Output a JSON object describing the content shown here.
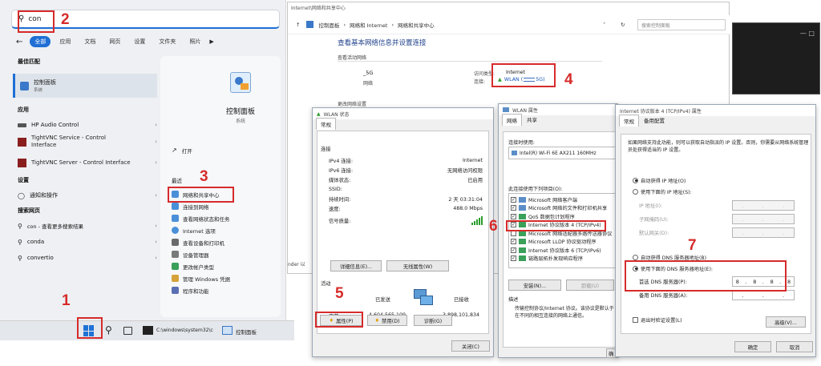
{
  "annotations": [
    "1",
    "2",
    "3",
    "4",
    "5",
    "6",
    "7"
  ],
  "start_menu": {
    "search_value": "con",
    "filters": [
      "全部",
      "应用",
      "文档",
      "网页",
      "设置",
      "文件夹",
      "照片"
    ],
    "best_match_header": "最佳匹配",
    "best_match": {
      "title": "控制面板",
      "subtitle": "系统"
    },
    "apps_header": "应用",
    "apps": [
      "HP Audio Control",
      "TightVNC Service - Control Interface",
      "TightVNC Server - Control Interface"
    ],
    "settings_header": "设置",
    "settings": [
      "通知和操作"
    ],
    "web_header": "搜索网页",
    "web": [
      "con - 查看更多搜索结果",
      "conda",
      "convertio"
    ],
    "right_title": "控制面板",
    "right_subtitle": "系统",
    "open_label": "打开",
    "recent_header": "最近",
    "recent": [
      "网络和共享中心",
      "连接到网络",
      "查看网络状态和任务",
      "Internet 选项",
      "查看设备和打印机",
      "设备管理器",
      "更改帐户类型",
      "管理 Windows 凭据",
      "程序和功能"
    ]
  },
  "taskbar": {
    "cmd": "C:\\windows\\system32\\c",
    "cp": "控制面板"
  },
  "network_center": {
    "title": "Internet\\网络和共享中心",
    "breadcrumb": [
      "控制面板",
      "网络和 Internet",
      "网络和共享中心"
    ],
    "search_placeholder": "搜索控制面板",
    "heading": "查看基本网络信息并设置连接",
    "active_label": "查看活动网络",
    "network_name": "_5G",
    "network_type": "网络",
    "access_label": "访问类型:",
    "access_value": "Internet",
    "conn_label": "连接:",
    "conn_value": "WLAN (",
    "conn_suffix": "5G)",
    "change_label": "更改网络设置",
    "left_stub": "nder 以",
    "right_stub": "1"
  },
  "wlan_status": {
    "title": "WLAN 状态",
    "tab": "常规",
    "connection_header": "连接",
    "rows": [
      {
        "k": "IPv4 连接:",
        "v": "Internet"
      },
      {
        "k": "IPv6 连接:",
        "v": "无网络访问权限"
      },
      {
        "k": "媒体状态:",
        "v": "已启用"
      },
      {
        "k": "SSID:",
        "v": ""
      },
      {
        "k": "持续时间:",
        "v": "2 天 03:31:04"
      },
      {
        "k": "速度:",
        "v": "488.0 Mbps"
      }
    ],
    "signal_label": "信号质量:",
    "detail_button": "详细信息(E)...",
    "wireless_button": "无线属性(W)",
    "activity_header": "活动",
    "sent_label": "已发送",
    "recv_label": "已接收",
    "bytes_label": "字节:",
    "sent_value": "4,604,565,109",
    "recv_value": "3,898,101,834",
    "prop_button": "属性(P)",
    "disable_button": "禁用(D)",
    "diag_button": "诊断(G)",
    "close_button": "关闭(C)"
  },
  "wlan_props": {
    "title": "WLAN 属性",
    "tabs": [
      "网络",
      "共享"
    ],
    "connect_using": "连接时使用:",
    "adapter": "Intel(R) Wi-Fi 6E AX211 160MHz",
    "items_label": "此连接使用下列项目(O):",
    "items": [
      "Microsoft 网络客户端",
      "Microsoft 网络的文件和打印机共享",
      "QoS 数据包计划程序",
      "Internet 协议版本 4 (TCP/IPv4)",
      "Microsoft 网络适配器多路传送器协议",
      "Microsoft LLDP 协议驱动程序",
      "Internet 协议版本 6 (TCP/IPv6)",
      "链路层拓扑发现响应程序"
    ],
    "install_button": "安装(N)...",
    "uninstall_button": "卸载(U)",
    "desc_header": "描述",
    "desc_text": "传输控制协议/Internet 协议。该协议是默认于在不同的相互连接的网络上通信。",
    "ok_stub": "确"
  },
  "ipv4": {
    "title": "Internet 协议版本 4 (TCP/IPv4) 属性",
    "tabs": [
      "常规",
      "备用配置"
    ],
    "intro": "如果网络支持此功能，则可以获取自动指派的 IP 设置。否则，你需要从网络系统管理员处获得适当的 IP 设置。",
    "auto_ip": "自动获得 IP 地址(O)",
    "manual_ip": "使用下面的 IP 地址(S):",
    "ip_label": "IP 地址(I):",
    "mask_label": "子网掩码(U):",
    "gateway_label": "默认网关(D):",
    "auto_dns": "自动获得 DNS 服务器地址(B)",
    "manual_dns": "使用下面的 DNS 服务器地址(E):",
    "pref_dns_label": "首选 DNS 服务器(P):",
    "pref_dns": [
      "8",
      "8",
      "8",
      "8"
    ],
    "alt_dns_label": "备用 DNS 服务器(A):",
    "validate": "退出时验证设置(L)",
    "advanced_button": "高级(V)...",
    "ok_button": "确定",
    "cancel_button": "取消"
  }
}
